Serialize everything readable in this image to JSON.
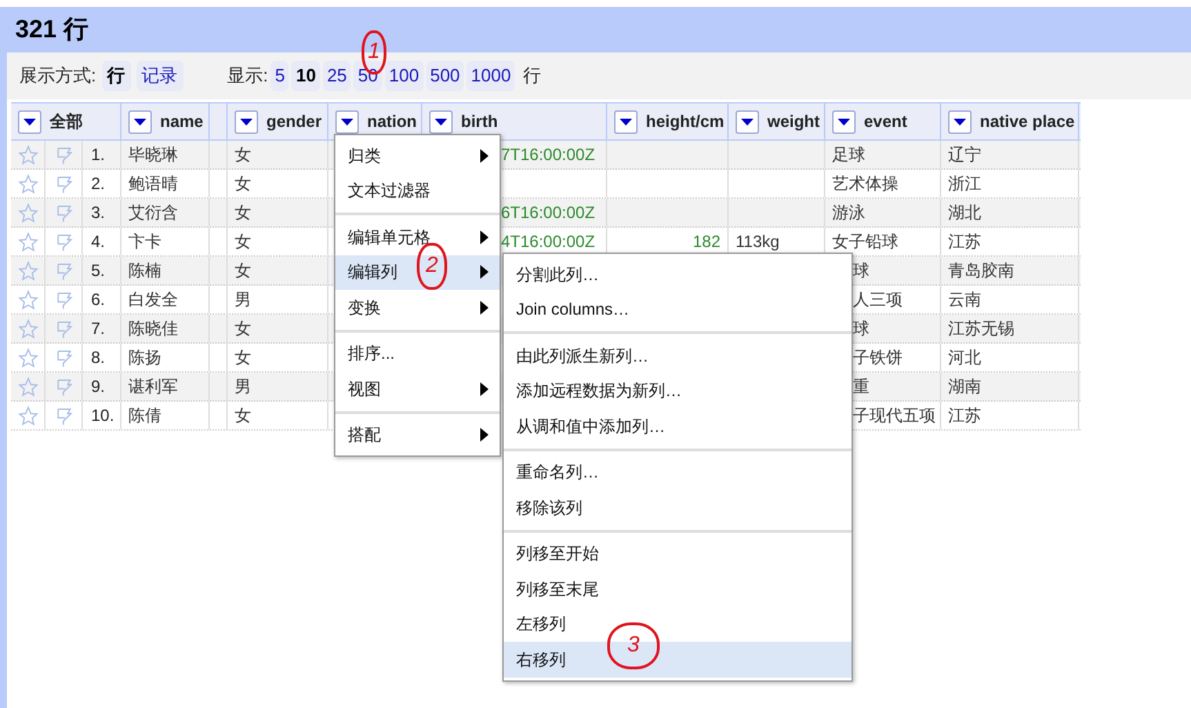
{
  "title": "321 行",
  "view_mode": {
    "label": "展示方式:",
    "options": [
      {
        "label": "行",
        "selected": true
      },
      {
        "label": "记录",
        "selected": false
      }
    ]
  },
  "page_size": {
    "label": "显示:",
    "options": [
      {
        "label": "5",
        "selected": false
      },
      {
        "label": "10",
        "selected": true
      },
      {
        "label": "25",
        "selected": false
      },
      {
        "label": "50",
        "selected": false
      },
      {
        "label": "100",
        "selected": false
      },
      {
        "label": "500",
        "selected": false
      },
      {
        "label": "1000",
        "selected": false
      }
    ],
    "suffix": "行"
  },
  "columns": [
    {
      "kind": "all",
      "label": "全部"
    },
    {
      "kind": "column",
      "label": "name"
    },
    {
      "kind": "spacer"
    },
    {
      "kind": "column",
      "label": "gender"
    },
    {
      "kind": "column",
      "label": "nation"
    },
    {
      "kind": "column",
      "label": "birth"
    },
    {
      "kind": "column",
      "label": "height/cm"
    },
    {
      "kind": "column",
      "label": "weight"
    },
    {
      "kind": "column",
      "label": "event"
    },
    {
      "kind": "column",
      "label": "native place"
    }
  ],
  "rows": [
    {
      "index": "1.",
      "cells": [
        {
          "text": "毕晓琳"
        },
        {
          "text": "女"
        },
        null,
        {
          "text": "7T16:00:00Z",
          "kind": "date",
          "clipped": true
        },
        null,
        null,
        {
          "text": "足球"
        },
        {
          "text": "辽宁"
        }
      ]
    },
    {
      "index": "2.",
      "cells": [
        {
          "text": "鲍语晴"
        },
        {
          "text": "女"
        },
        null,
        null,
        null,
        null,
        {
          "text": "艺术体操"
        },
        {
          "text": "浙江"
        }
      ]
    },
    {
      "index": "3.",
      "cells": [
        {
          "text": "艾衍含"
        },
        {
          "text": "女"
        },
        null,
        {
          "text": "6T16:00:00Z",
          "kind": "date",
          "clipped": true
        },
        null,
        null,
        {
          "text": "游泳"
        },
        {
          "text": "湖北"
        }
      ]
    },
    {
      "index": "4.",
      "cells": [
        {
          "text": "卞卡"
        },
        {
          "text": "女"
        },
        null,
        {
          "text": "4T16:00:00Z",
          "kind": "date",
          "clipped": true
        },
        {
          "text": "182",
          "kind": "number"
        },
        {
          "text": "113kg"
        },
        {
          "text": "女子铅球"
        },
        {
          "text": "江苏"
        }
      ]
    },
    {
      "index": "5.",
      "cells": [
        {
          "text": "陈楠"
        },
        {
          "text": "女"
        },
        null,
        null,
        null,
        null,
        {
          "text": "球",
          "clipped": true
        },
        {
          "text": "青岛胶南"
        }
      ]
    },
    {
      "index": "6.",
      "cells": [
        {
          "text": "白发全"
        },
        {
          "text": "男"
        },
        null,
        null,
        null,
        null,
        {
          "text": "人三项",
          "clipped": true
        },
        {
          "text": "云南"
        }
      ]
    },
    {
      "index": "7.",
      "cells": [
        {
          "text": "陈晓佳"
        },
        {
          "text": "女"
        },
        null,
        null,
        null,
        null,
        {
          "text": "球",
          "clipped": true
        },
        {
          "text": "江苏无锡"
        }
      ]
    },
    {
      "index": "8.",
      "cells": [
        {
          "text": "陈扬"
        },
        {
          "text": "女"
        },
        null,
        null,
        null,
        null,
        {
          "text": "子铁饼",
          "clipped": true
        },
        {
          "text": "河北"
        }
      ]
    },
    {
      "index": "9.",
      "cells": [
        {
          "text": "谌利军"
        },
        {
          "text": "男"
        },
        null,
        null,
        null,
        null,
        {
          "text": "重",
          "clipped": true
        },
        {
          "text": "湖南"
        }
      ]
    },
    {
      "index": "10.",
      "cells": [
        {
          "text": "陈倩"
        },
        {
          "text": "女"
        },
        null,
        null,
        null,
        null,
        {
          "text": "子现代五项",
          "clipped": true
        },
        {
          "text": "江苏"
        }
      ]
    }
  ],
  "column_menu": [
    {
      "kind": "item",
      "label": "归类",
      "has_submenu": true,
      "selected": false
    },
    {
      "kind": "item",
      "label": "文本过滤器",
      "has_submenu": false,
      "selected": false
    },
    {
      "kind": "separator"
    },
    {
      "kind": "item",
      "label": "编辑单元格",
      "has_submenu": true,
      "selected": false
    },
    {
      "kind": "item",
      "label": "编辑列",
      "has_submenu": true,
      "selected": true
    },
    {
      "kind": "item",
      "label": "变换",
      "has_submenu": true,
      "selected": false
    },
    {
      "kind": "separator"
    },
    {
      "kind": "item",
      "label": "排序...",
      "has_submenu": false,
      "selected": false
    },
    {
      "kind": "item",
      "label": "视图",
      "has_submenu": true,
      "selected": false
    },
    {
      "kind": "separator"
    },
    {
      "kind": "item",
      "label": "搭配",
      "has_submenu": true,
      "selected": false
    }
  ],
  "submenu": [
    {
      "kind": "item",
      "label": "分割此列…",
      "selected": false
    },
    {
      "kind": "item",
      "label": "Join columns…",
      "selected": false
    },
    {
      "kind": "separator"
    },
    {
      "kind": "item",
      "label": "由此列派生新列…",
      "selected": false
    },
    {
      "kind": "item",
      "label": "添加远程数据为新列…",
      "selected": false
    },
    {
      "kind": "item",
      "label": "从调和值中添加列…",
      "selected": false
    },
    {
      "kind": "separator"
    },
    {
      "kind": "item",
      "label": "重命名列…",
      "selected": false
    },
    {
      "kind": "item",
      "label": "移除该列",
      "selected": false
    },
    {
      "kind": "separator"
    },
    {
      "kind": "item",
      "label": "列移至开始",
      "selected": false
    },
    {
      "kind": "item",
      "label": "列移至末尾",
      "selected": false
    },
    {
      "kind": "item",
      "label": "左移列",
      "selected": false
    },
    {
      "kind": "item",
      "label": "右移列",
      "selected": true
    }
  ],
  "annotations": [
    {
      "label": "1"
    },
    {
      "label": "2"
    },
    {
      "label": "3"
    }
  ]
}
